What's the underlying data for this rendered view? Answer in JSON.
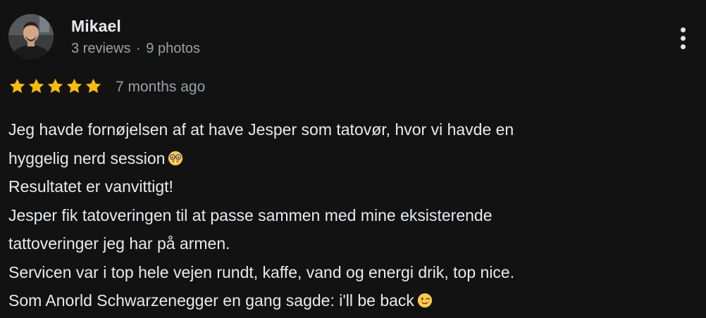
{
  "review": {
    "author": {
      "name": "Mikael",
      "reviews_count": "3 reviews",
      "separator": "·",
      "photos_count": "9 photos",
      "avatar_icon": "user-avatar-photo"
    },
    "rating": {
      "stars": 5,
      "max_stars": 5,
      "star_color": "#fbbc04"
    },
    "date": "7 months ago",
    "more_icon": "more-vert-icon",
    "text_lines": [
      "Jeg havde fornøjelsen af at have Jesper som tatovør, hvor vi havde en",
      "hyggelig nerd session",
      "Resultatet er vanvittigt!",
      "Jesper fik tatoveringen til at passe sammen med mine eksisterende",
      "tattoveringer jeg har på armen.",
      "Servicen var i top hele vejen rundt, kaffe, vand og energi drik, top nice.",
      "Som Anorld Schwarzenegger en gang sagde: i'll be back"
    ],
    "emojis": {
      "line_2": "nerd-face-emoji",
      "line_7": "winking-face-emoji"
    }
  },
  "colors": {
    "background": "#121212",
    "primary_text": "#e8eaed",
    "secondary_text": "#9aa0a6"
  }
}
